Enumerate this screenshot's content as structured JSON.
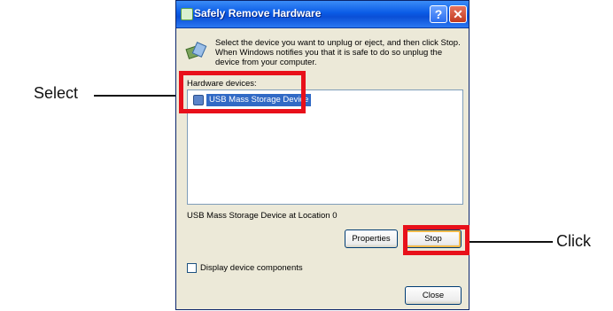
{
  "window": {
    "title": "Safely Remove Hardware",
    "help_glyph": "?",
    "close_glyph": "✕"
  },
  "dialog": {
    "instruction": "Select the device you want to unplug or eject, and then click Stop. When Windows notifies you that it is safe to do so unplug the device from your computer.",
    "hardware_devices_label": "Hardware devices:",
    "devices": [
      {
        "label": "USB Mass Storage Device",
        "selected": true
      }
    ],
    "location_text": "USB Mass Storage Device at Location 0",
    "properties_button": "Properties",
    "stop_button": "Stop",
    "display_components_label": "Display device components",
    "display_components_checked": false,
    "close_button": "Close"
  },
  "callouts": {
    "select": "Select",
    "click": "Click"
  },
  "colors": {
    "highlight": "#e8101a",
    "titlebar": "#0a5be6",
    "selection": "#316ac5"
  }
}
